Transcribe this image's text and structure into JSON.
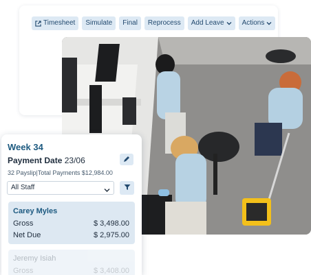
{
  "toolbar": {
    "buttons": [
      {
        "label": "Timesheet",
        "icon": "external-link-icon"
      },
      {
        "label": "Simulate"
      },
      {
        "label": "Final"
      },
      {
        "label": "Reprocess"
      },
      {
        "label": "Add Leave",
        "icon": "chevron-down-icon"
      },
      {
        "label": "Actions",
        "icon": "chevron-down-icon"
      }
    ]
  },
  "payslip": {
    "week": "Week 34",
    "payment_date_label": "Payment Date",
    "payment_date": "23/06",
    "summary": "32 Payslip|Total Payments $12,984.00",
    "filter_select": "All Staff",
    "employees": [
      {
        "name": "Carey Myles",
        "gross_label": "Gross",
        "gross": "$ 3,498.00",
        "net_label": "Net Due",
        "net": "$ 2,975.00"
      },
      {
        "name": "Jeremy Isiah",
        "gross_label": "Gross",
        "gross": "$ 3,408.00"
      }
    ]
  },
  "colors": {
    "accent": "#1d5a80",
    "button_bg": "#dde9f4",
    "row_bg": "#dde8f2"
  }
}
